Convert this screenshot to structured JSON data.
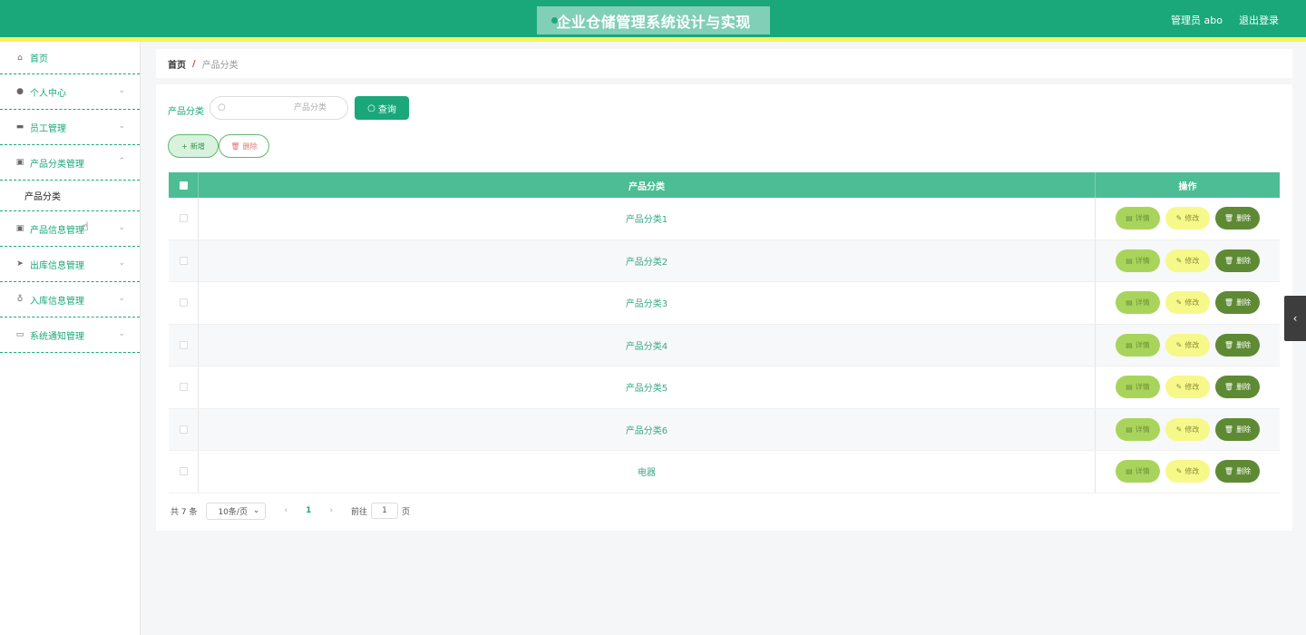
{
  "header": {
    "title": "企业仓储管理系统设计与实现",
    "user_label": "管理员 abo",
    "logout_label": "退出登录"
  },
  "sidebar": {
    "items": [
      {
        "label": "首页",
        "icon": "home-icon"
      },
      {
        "label": "个人中心",
        "icon": "user-icon"
      },
      {
        "label": "员工管理",
        "icon": "staff-icon"
      },
      {
        "label": "产品分类管理",
        "icon": "clipboard-icon"
      },
      {
        "label": "产品信息管理",
        "icon": "clipboard-icon"
      },
      {
        "label": "出库信息管理",
        "icon": "send-icon"
      },
      {
        "label": "入库信息管理",
        "icon": "mic-icon"
      },
      {
        "label": "系统通知管理",
        "icon": "message-icon"
      }
    ],
    "sub_item": "产品分类"
  },
  "breadcrumb": {
    "home": "首页",
    "separator": "/",
    "current": "产品分类"
  },
  "search": {
    "label": "产品分类",
    "placeholder": "产品分类",
    "query_label": "查询"
  },
  "actions": {
    "add_label": "新增",
    "delete_label": "删除"
  },
  "table": {
    "columns": [
      "产品分类",
      "操作"
    ],
    "rows": [
      "产品分类1",
      "产品分类2",
      "产品分类3",
      "产品分类4",
      "产品分类5",
      "产品分类6",
      "电器"
    ],
    "detail_label": "详情",
    "edit_label": "修改",
    "delete_label": "删除"
  },
  "pager": {
    "total": "共 7 条",
    "page_size": "10条/页",
    "current_page": "1",
    "goto_label": "前往",
    "goto_value": "1",
    "page_suffix": "页"
  },
  "colors": {
    "primary": "#1aa87a",
    "header_accent": "#f2f55a",
    "table_header": "#4cbd95"
  }
}
